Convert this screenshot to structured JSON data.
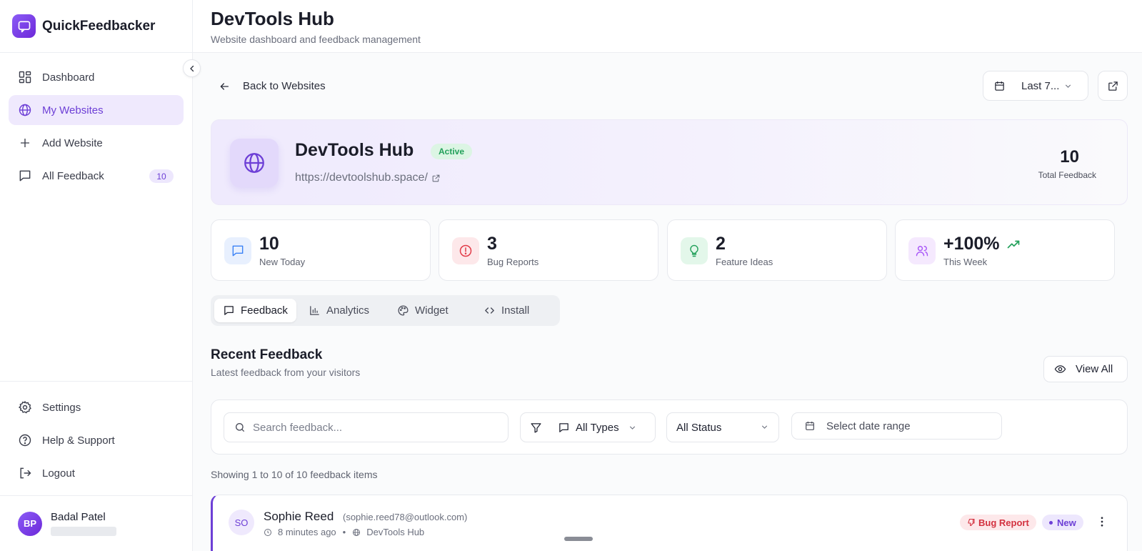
{
  "app": {
    "name": "QuickFeedbacker",
    "accent_color": "#6d3fd6"
  },
  "sidebar": {
    "items": [
      {
        "label": "Dashboard",
        "icon": "dashboard-icon"
      },
      {
        "label": "My Websites",
        "icon": "globe-icon",
        "active": true
      },
      {
        "label": "Add Website",
        "icon": "plus-icon"
      },
      {
        "label": "All Feedback",
        "icon": "message-icon",
        "badge": "10"
      }
    ],
    "bottom_items": [
      {
        "label": "Settings",
        "icon": "gear-icon"
      },
      {
        "label": "Help & Support",
        "icon": "help-icon"
      },
      {
        "label": "Logout",
        "icon": "logout-icon"
      }
    ],
    "user": {
      "initials": "BP",
      "name": "Badal Patel"
    }
  },
  "header": {
    "title": "DevTools Hub",
    "subtitle": "Website dashboard and feedback management"
  },
  "main": {
    "back_label": "Back to Websites",
    "range_label": "Last 7...",
    "site": {
      "name": "DevTools Hub",
      "status": "Active",
      "url": "https://devtoolshub.space/",
      "total_value": "10",
      "total_label": "Total Feedback"
    },
    "stats": [
      {
        "value": "10",
        "label": "New Today",
        "icon": "message-icon",
        "color": "#3b82f6"
      },
      {
        "value": "3",
        "label": "Bug Reports",
        "icon": "alert-circle-icon",
        "color": "#e23b48"
      },
      {
        "value": "2",
        "label": "Feature Ideas",
        "icon": "lightbulb-icon",
        "color": "#22a05a"
      },
      {
        "value": "+100%",
        "label": "This Week",
        "icon": "users-icon",
        "color": "#a855f7"
      }
    ],
    "tabs": [
      {
        "label": "Feedback",
        "icon": "message-icon",
        "active": true
      },
      {
        "label": "Analytics",
        "icon": "bar-chart-icon"
      },
      {
        "label": "Widget",
        "icon": "palette-icon"
      },
      {
        "label": "Install",
        "icon": "code-icon"
      }
    ],
    "recent": {
      "title": "Recent Feedback",
      "subtitle": "Latest feedback from your visitors",
      "view_all": "View All"
    },
    "filters": {
      "search_placeholder": "Search feedback...",
      "types": "All Types",
      "status": "All Status",
      "date_placeholder": "Select date range"
    },
    "showing": "Showing 1 to 10 of 10 feedback items",
    "feedback": [
      {
        "initials": "SO",
        "name": "Sophie Reed",
        "email": "(sophie.reed78@outlook.com)",
        "time": "8 minutes ago",
        "site": "DevTools Hub",
        "type": "Bug Report",
        "status": "New"
      }
    ]
  }
}
